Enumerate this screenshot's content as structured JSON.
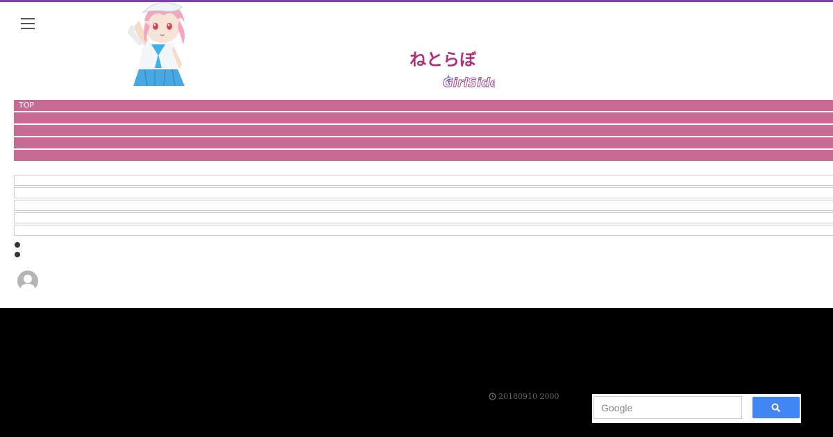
{
  "header": {
    "accent_color": "#7b3fb3",
    "menu_icon": "hamburger-icon",
    "mascot_alt": "mascot-character",
    "logo_text": "ねとらぼ",
    "logo_sub": "GirlSide"
  },
  "nav": {
    "color": "#c76b94",
    "items": [
      "TOP",
      "",
      "",
      "",
      ""
    ]
  },
  "list": {
    "rows": [
      "",
      "",
      "",
      "",
      ""
    ]
  },
  "footer": {
    "date_text": "20180910 2000",
    "clock_icon": "clock-icon",
    "search": {
      "placeholder": "Google",
      "button_color": "#4285f4",
      "button_icon": "search-icon"
    }
  }
}
